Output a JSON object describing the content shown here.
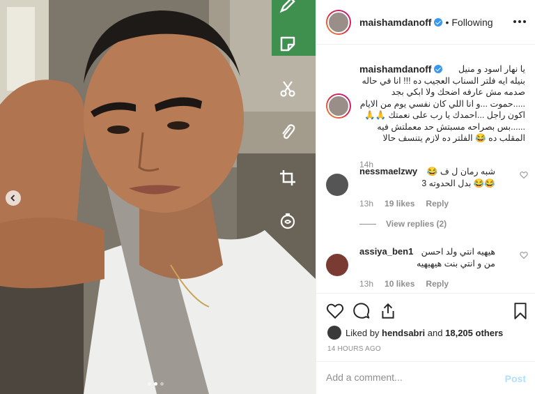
{
  "post": {
    "author": "maishamdanoff",
    "follow_status": "Following",
    "bullet": "•"
  },
  "caption": {
    "username": "maishamdanoff",
    "text": "يا نهار اسود و منيل بنيله ايه فلتر السناب العجيب ده !!! انا في حاله صدمه مش عارفه اضحك ولا ابكي بجد .....حموت ...و انا اللي كان نفسي يوم من الايام اكون راجل ...احمدك يا رب على نعمتك 🙏🙏 ......بس بصراحه مسبتش حد معملتش فيه المقلب ده 😂 الفلتر ده لازم يتنسف حالا",
    "time": "14h"
  },
  "comments": [
    {
      "username": "nessmaelzwy",
      "text": "شبه رمان ل ف 😂😂😂 بدل الحدوته 3",
      "time": "13h",
      "likes": "19 likes",
      "reply_label": "Reply"
    },
    {
      "username": "assiya_ben1",
      "text": "هيهيه انتي ولد احسن من و انتي بنت هيهيهيه",
      "time": "13h",
      "likes": "10 likes",
      "reply_label": "Reply"
    }
  ],
  "view_replies": "View replies (2)",
  "likes": {
    "prefix": "Liked by",
    "user": "hendsabri",
    "middle": "and",
    "others": "18,205 others"
  },
  "timestamp": "14 HOURS AGO",
  "add_comment": {
    "placeholder": "Add a comment...",
    "post_label": "Post"
  },
  "carousel": {
    "count": 3,
    "active_index": 1
  },
  "colors": {
    "text": "#262626",
    "muted": "#8e8e8e",
    "verified": "#3897f0",
    "post_disabled": "#b2dffc",
    "border": "#efefef"
  },
  "icons": [
    "chevron-left-icon",
    "pencil-icon",
    "sticker-icon",
    "scissors-icon",
    "paperclip-icon",
    "crop-icon",
    "timer-icon",
    "more-icon",
    "heart-icon",
    "comment-icon",
    "share-icon",
    "bookmark-icon",
    "verified-badge-icon"
  ]
}
